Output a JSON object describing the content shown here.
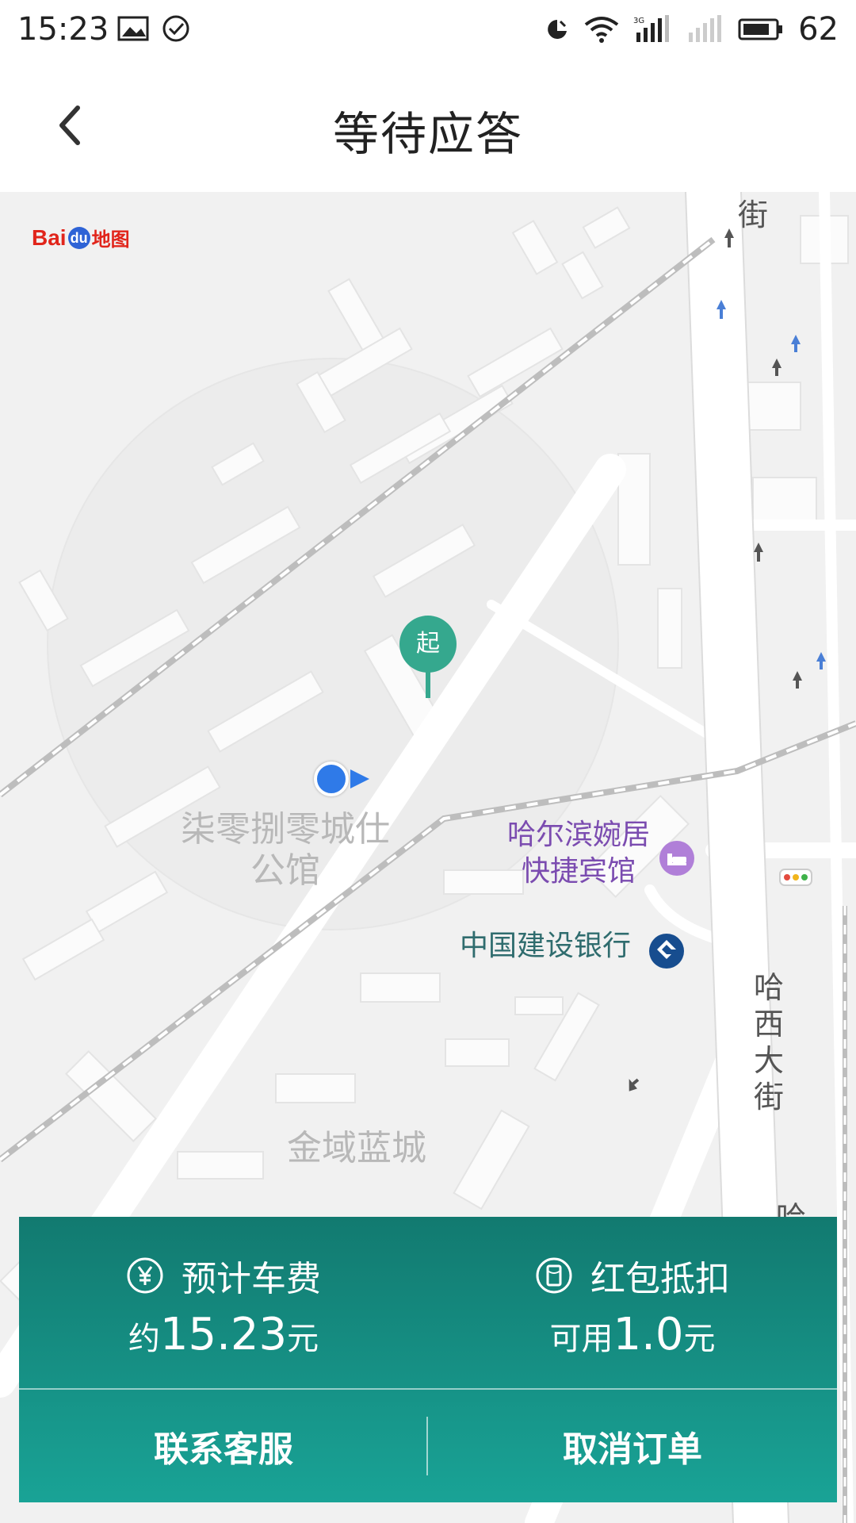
{
  "status_bar": {
    "time": "15:23",
    "battery": "62",
    "icons": [
      "image-icon",
      "check-circle-icon",
      "nfc-icon",
      "wifi-icon",
      "signal-3g-icon",
      "signal-icon",
      "battery-icon"
    ]
  },
  "header": {
    "title": "等待应答",
    "back_icon": "chevron-left-icon"
  },
  "map": {
    "provider_logo": {
      "prefix": "Bai",
      "du": "du",
      "suffix": "地图"
    },
    "labels": {
      "district_1_line1": "柒零捌零城仕",
      "district_1_line2": "公馆",
      "hotel_line1": "哈尔滨婉居",
      "hotel_line2": "快捷宾馆",
      "bank": "中国建设银行",
      "road_vertical": [
        "哈",
        "西",
        "大",
        "街"
      ],
      "road_top": "街",
      "road_bottom": "哈",
      "community": "金域蓝城"
    },
    "start_marker": "起"
  },
  "fare_panel": {
    "estimate_label": "预计车费",
    "estimate_prefix": "约",
    "estimate_value": "15.23",
    "estimate_unit": "元",
    "redpacket_label": "红包抵扣",
    "redpacket_prefix": "可用",
    "redpacket_value": "1.0",
    "redpacket_unit": "元",
    "contact_button": "联系客服",
    "cancel_button": "取消订单"
  },
  "colors": {
    "panel_top": "#127a70",
    "panel_bottom": "#19a396",
    "start_pin": "#35a88e",
    "location_dot": "#2f7ae8",
    "poi_purple": "#7b4cb0"
  }
}
